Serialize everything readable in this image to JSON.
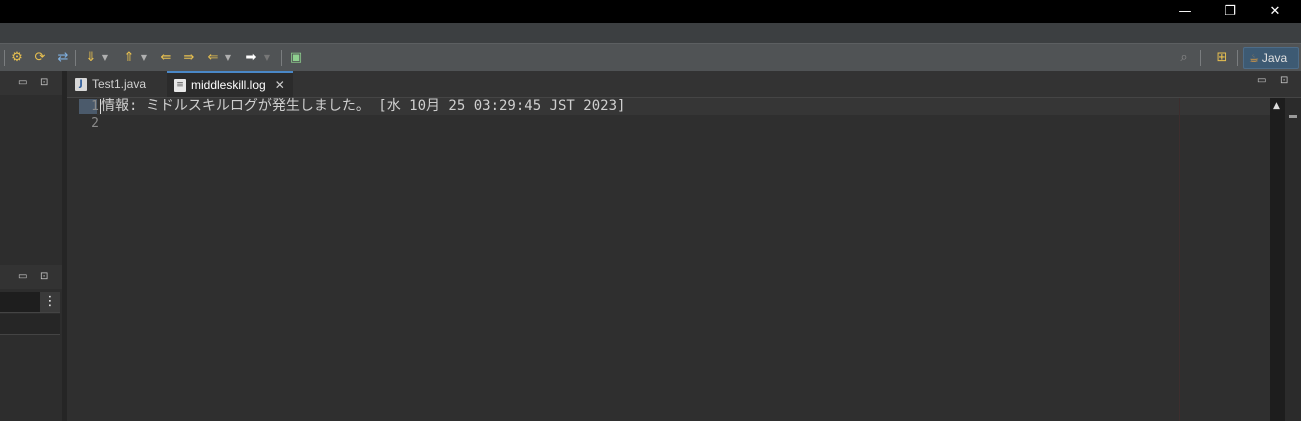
{
  "window": {
    "minimize_icon": "—",
    "restore_icon": "❐",
    "close_icon": "✕"
  },
  "toolbar": {
    "icons": [
      "build-icon",
      "refresh-icon",
      "sync-icon",
      "next-annotation-icon",
      "prev-annotation-icon",
      "last-edit-icon",
      "forward-edit-icon",
      "back-icon",
      "forward-icon",
      "open-task-icon"
    ],
    "search_icon": "🔍"
  },
  "perspective": {
    "label": "Java"
  },
  "left_panel": {
    "minimize": "▭",
    "maximize": "⊡",
    "menu_dots": "⋮"
  },
  "editor": {
    "tabs": [
      {
        "label": "Test1.java",
        "icon": "java-file-icon",
        "active": false
      },
      {
        "label": "middleskill.log",
        "icon": "text-file-icon",
        "active": true,
        "close": "✕"
      }
    ],
    "lines": [
      {
        "number": "1",
        "text": "情報: ミドルスキルログが発生しました。 [水 10月 25 03:29:45 JST 2023]"
      },
      {
        "number": "2",
        "text": ""
      }
    ],
    "scroll_up_arrow": "▲"
  }
}
